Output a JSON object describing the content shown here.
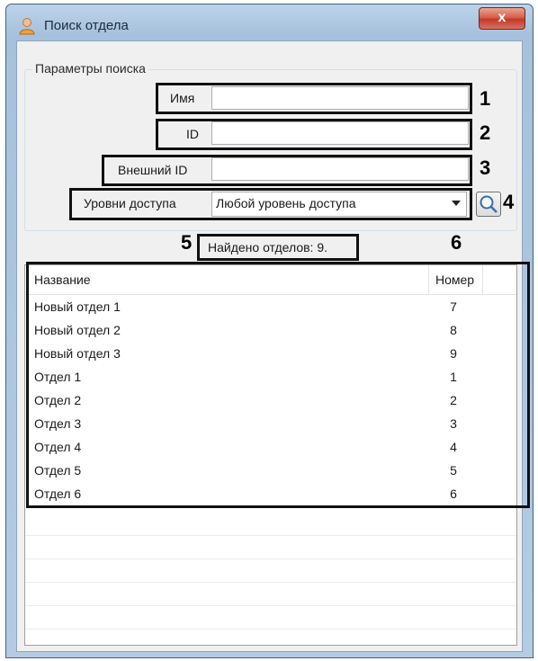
{
  "window": {
    "title": "Поиск отдела",
    "close_label": "x"
  },
  "search_params": {
    "legend": "Параметры поиска",
    "name_label": "Имя",
    "name_value": "",
    "id_label": "ID",
    "id_value": "",
    "external_id_label": "Внешний ID",
    "external_id_value": "",
    "access_levels_label": "Уровни доступа",
    "access_levels_selected": "Любой уровень доступа"
  },
  "callouts": [
    "1",
    "2",
    "3",
    "4",
    "5",
    "6"
  ],
  "results": {
    "found_text": "Найдено отделов: 9.",
    "columns": [
      "Название",
      "Номер"
    ],
    "rows": [
      {
        "name": "Новый отдел 1",
        "number": "7"
      },
      {
        "name": "Новый отдел 2",
        "number": "8"
      },
      {
        "name": "Новый отдел 3",
        "number": "9"
      },
      {
        "name": "Отдел 1",
        "number": "1"
      },
      {
        "name": "Отдел 2",
        "number": "2"
      },
      {
        "name": "Отдел 3",
        "number": "3"
      },
      {
        "name": "Отдел 4",
        "number": "4"
      },
      {
        "name": "Отдел 5",
        "number": "5"
      },
      {
        "name": "Отдел 6",
        "number": "6"
      }
    ]
  }
}
